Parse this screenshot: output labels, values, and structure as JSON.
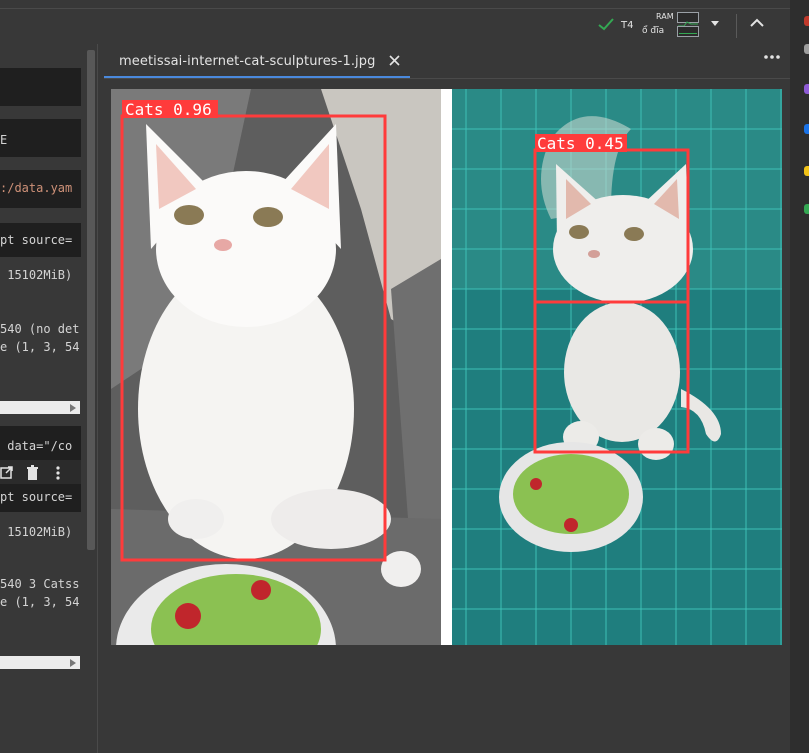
{
  "toolbar": {
    "gpu_label": "T4",
    "ram_label": "RAM",
    "disk_label": "ổ đĩa"
  },
  "left_cells": {
    "line_1": "E",
    "line_2": ":/data.yam",
    "line_3": "pt source=",
    "line_4": " 15102MiB)",
    "line_5": "540 (no det",
    "line_6": "e (1, 3, 54",
    "line_7": " data=\"/co",
    "line_8": "pt source=",
    "line_9": " 15102MiB)",
    "line_10": "540 3 Catss",
    "line_11": "e (1, 3, 54"
  },
  "viewer": {
    "tab_title": "meetissai-internet-cat-sculptures-1.jpg",
    "more_label": "⋮"
  },
  "image": {
    "detections": [
      {
        "label": "Cats 0.96"
      },
      {
        "label": "Cats 0.45"
      }
    ],
    "box_color": "#ff3b3b"
  },
  "colors": {
    "accent": "#4a89dc",
    "ok": "#34a853",
    "background": "#383838"
  }
}
